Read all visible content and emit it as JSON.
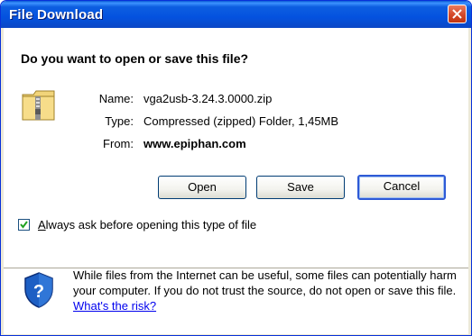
{
  "window": {
    "title": "File Download",
    "close_icon": "close-icon"
  },
  "dialog": {
    "question": "Do you want to open or save this file?",
    "file_icon": "zip-folder-icon",
    "info": {
      "name_label": "Name:",
      "name_value": "vga2usb-3.24.3.0000.zip",
      "type_label": "Type:",
      "type_value": "Compressed (zipped) Folder, 1,45MB",
      "from_label": "From:",
      "from_value": "www.epiphan.com"
    },
    "buttons": {
      "open_label_first": "O",
      "open_label_rest": "pen",
      "save_label_first": "S",
      "save_label_rest": "ave",
      "cancel_label": "Cancel"
    },
    "checkbox": {
      "checked": true,
      "label_first": "A",
      "label_rest": "lways ask before opening this type of file"
    },
    "warning": {
      "icon": "shield-question-icon",
      "text": "While files from the Internet can be useful, some files can potentially harm your computer. If you do not trust the source, do not open or save this file. ",
      "link": "What's the risk?"
    }
  },
  "colors": {
    "titlebar": "#0452df",
    "dialog_bg": "#ece9d8",
    "link": "#0000ee",
    "close_button": "#d4482a"
  }
}
